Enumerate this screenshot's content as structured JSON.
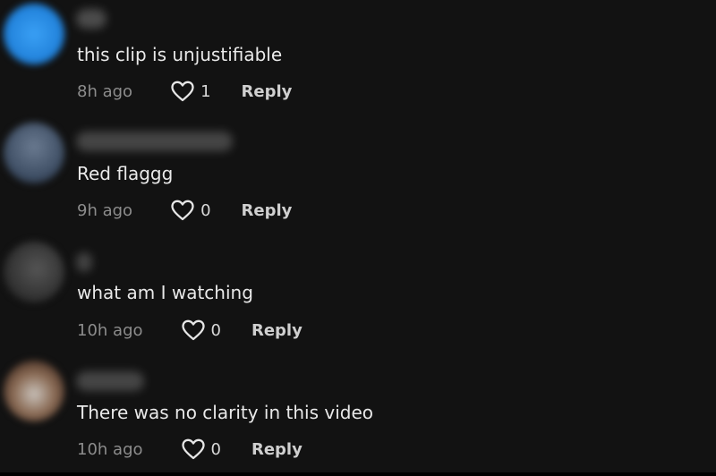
{
  "comments": [
    {
      "text": "this clip is unjustifiable",
      "time": "8h ago",
      "likes": "1",
      "reply_label": "Reply",
      "avatar_color": "#2d8ee6"
    },
    {
      "text": "Red flaggg",
      "time": "9h ago",
      "likes": "0",
      "reply_label": "Reply",
      "avatar_color": "#4a5a70"
    },
    {
      "text": "what am I watching",
      "time": "10h ago",
      "likes": "0",
      "reply_label": "Reply",
      "avatar_color": "#3a3a3a"
    },
    {
      "text": "There was no clarity in this video",
      "time": "10h ago",
      "likes": "0",
      "reply_label": "Reply",
      "avatar_color": "#6b4a3a"
    }
  ]
}
